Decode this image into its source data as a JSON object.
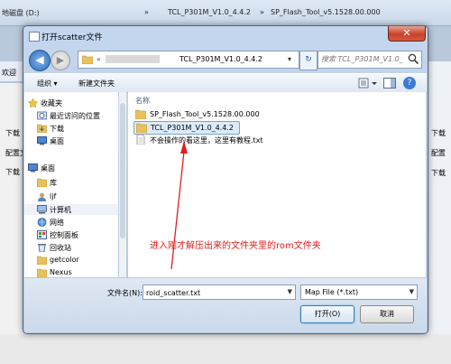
{
  "background": {
    "address": [
      "地磁盘 (D:)",
      "»",
      "TCL_P301M_V1.0_4.4.2",
      "»",
      "SP_Flash_Tool_v5.1528.00.000"
    ],
    "left_panel_items": [
      "欢迎",
      "下载",
      "配置文",
      "下载"
    ],
    "right_panel_items": [
      "下载",
      "配置",
      "下载"
    ]
  },
  "dialog": {
    "title": "打开scatter文件",
    "close_glyph": "✕",
    "nav": {
      "back_glyph": "◀",
      "forward_glyph": "▶",
      "address_prefix": "«",
      "address_path": "TCL_P301M_V1.0_4.4.2",
      "address_arrow": "▾",
      "refresh_glyph": "↻",
      "search_placeholder": "搜索 TCL_P301M_V1.0_4.4.2"
    },
    "toolbar": {
      "organize_label": "组织 ▾",
      "new_folder_label": "新建文件夹",
      "help_glyph": "?"
    },
    "nav_pane": {
      "items": [
        {
          "label": "收藏夹",
          "icon": "star-icon"
        },
        {
          "label": "最近访问的位置",
          "icon": "recent-places-icon"
        },
        {
          "label": "下载",
          "icon": "download-folder-icon"
        },
        {
          "label": "桌面",
          "icon": "desktop-icon"
        },
        {
          "label": "桌面",
          "icon": "desktop-icon"
        },
        {
          "label": "库",
          "icon": "library-icon"
        },
        {
          "label": "ljf",
          "icon": "user-folder-icon"
        },
        {
          "label": "计算机",
          "icon": "computer-icon"
        },
        {
          "label": "网络",
          "icon": "network-icon"
        },
        {
          "label": "控制面板",
          "icon": "control-panel-icon"
        },
        {
          "label": "回收站",
          "icon": "recycle-bin-icon"
        },
        {
          "label": "getcolor",
          "icon": "folder-icon"
        },
        {
          "label": "Nexus",
          "icon": "folder-icon"
        }
      ]
    },
    "files": {
      "column_header": "名称",
      "rows": [
        {
          "label": "SP_Flash_Tool_v5.1528.00.000",
          "icon": "folder-icon",
          "selected": false
        },
        {
          "label": "TCL_P301M_V1.0_4.4.2",
          "icon": "folder-icon",
          "selected": true
        },
        {
          "label": "不会操作的看这里，这里有教程.txt",
          "icon": "text-file-icon",
          "selected": false
        }
      ]
    },
    "annotation": "进入刚才解压出来的文件夹里的rom文件夹",
    "filename_label": "文件名(N):",
    "filename_value": "roid_scatter.txt",
    "filetype_value": "Map File (*.txt)",
    "open_label": "打开(O)",
    "cancel_label": "取消"
  },
  "colors": {
    "annotation": "#e02020",
    "selection": "#dcebfc"
  }
}
